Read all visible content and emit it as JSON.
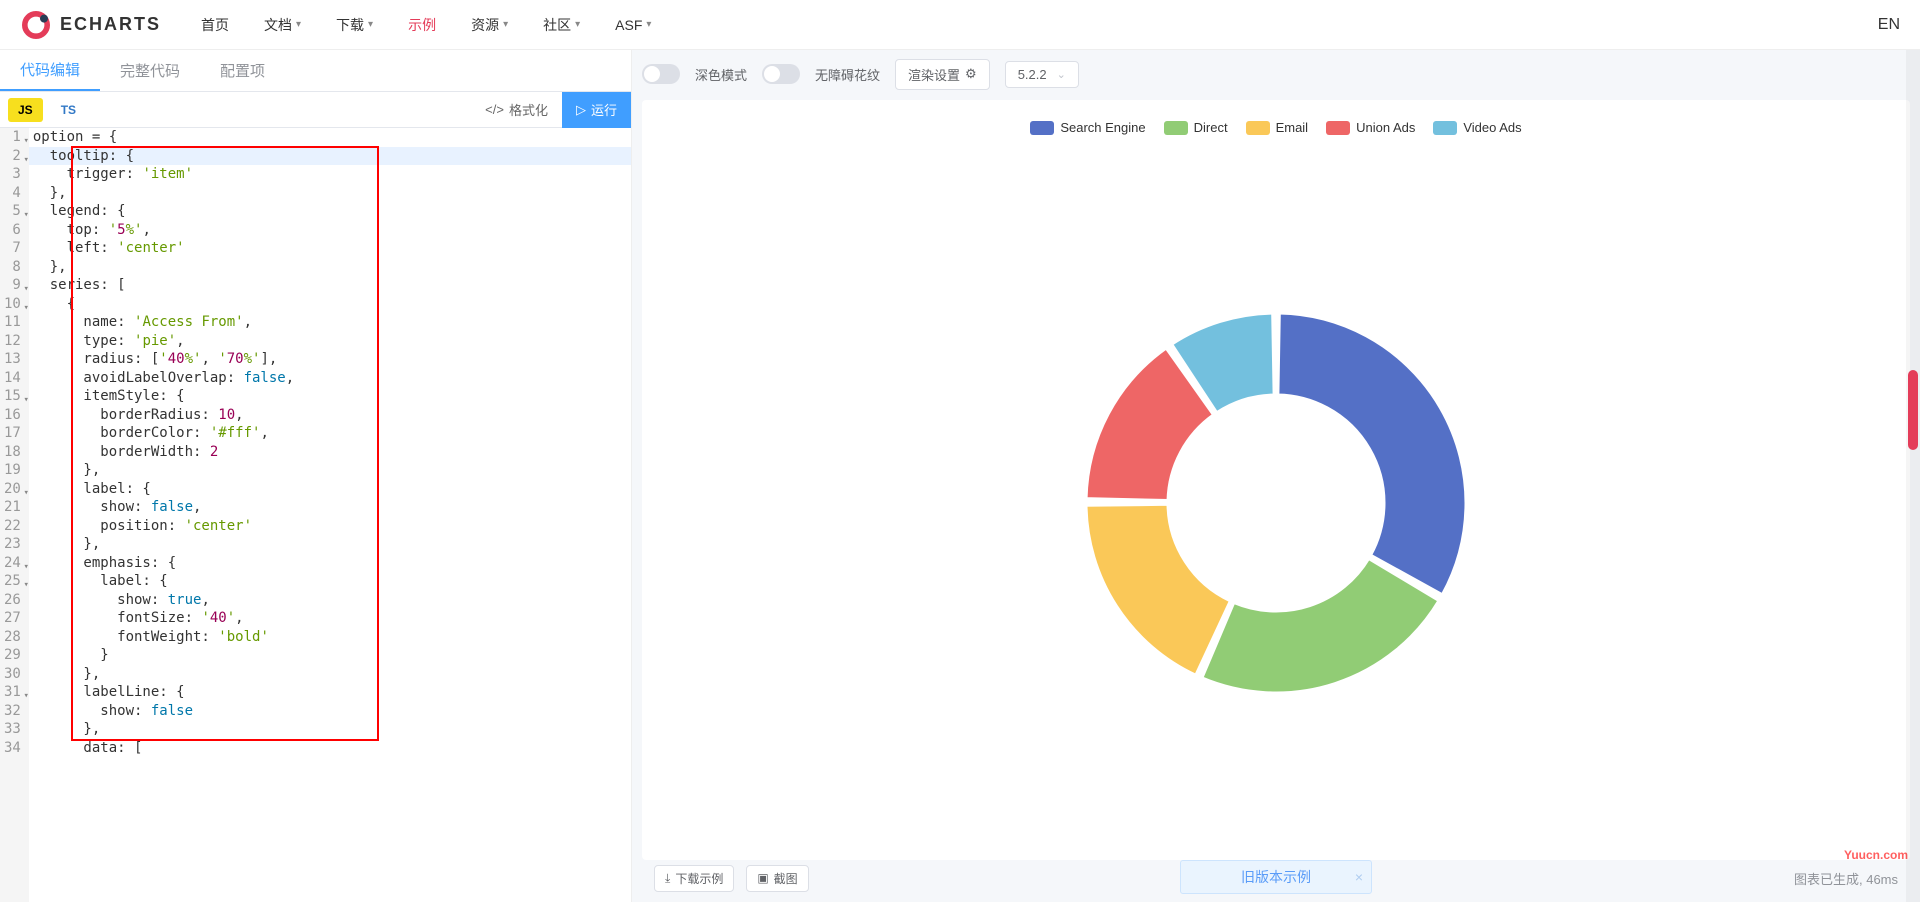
{
  "header": {
    "brand": "ECHARTS",
    "nav": [
      "首页",
      "文档",
      "下载",
      "示例",
      "资源",
      "社区",
      "ASF"
    ],
    "nav_has_chev": [
      false,
      true,
      true,
      false,
      true,
      true,
      true
    ],
    "active_index": 3,
    "lang": "EN"
  },
  "sub_tabs": {
    "items": [
      "代码编辑",
      "完整代码",
      "配置项"
    ],
    "active": 0
  },
  "lang_buttons": {
    "js": "JS",
    "ts": "TS"
  },
  "actions": {
    "format": "格式化",
    "run": "运行"
  },
  "controls": {
    "dark_mode": "深色模式",
    "a11y": "无障碍花纹",
    "render": "渲染设置",
    "version": "5.2.2"
  },
  "editor_lines": [
    "option = {",
    "  tooltip: {",
    "    trigger: 'item'",
    "  },",
    "  legend: {",
    "    top: '5%',",
    "    left: 'center'",
    "  },",
    "  series: [",
    "    {",
    "      name: 'Access From',",
    "      type: 'pie',",
    "      radius: ['40%', '70%'],",
    "      avoidLabelOverlap: false,",
    "      itemStyle: {",
    "        borderRadius: 10,",
    "        borderColor: '#fff',",
    "        borderWidth: 2",
    "      },",
    "      label: {",
    "        show: false,",
    "        position: 'center'",
    "      },",
    "      emphasis: {",
    "        label: {",
    "          show: true,",
    "          fontSize: '40',",
    "          fontWeight: 'bold'",
    "        }",
    "      },",
    "      labelLine: {",
    "        show: false",
    "      },",
    "      data: ["
  ],
  "foldable": [
    1,
    2,
    5,
    9,
    10,
    15,
    20,
    24,
    25,
    31
  ],
  "highlighted_line": 2,
  "chart_data": {
    "type": "pie",
    "subtype": "doughnut",
    "series_name": "Access From",
    "radius_inner_pct": 40,
    "radius_outer_pct": 70,
    "border_radius": 10,
    "border_color": "#fff",
    "border_width": 2,
    "legend_position": "top-center",
    "items": [
      {
        "name": "Search Engine",
        "value": 1048,
        "color": "#5470c6"
      },
      {
        "name": "Direct",
        "value": 735,
        "color": "#91cc75"
      },
      {
        "name": "Email",
        "value": 580,
        "color": "#fac858"
      },
      {
        "name": "Union Ads",
        "value": 484,
        "color": "#ee6666"
      },
      {
        "name": "Video Ads",
        "value": 300,
        "color": "#73c0de"
      }
    ]
  },
  "footer": {
    "download": "下载示例",
    "screenshot": "截图",
    "banner": "旧版本示例",
    "status": "图表已生成, 46ms",
    "watermark": "Yuucn.com"
  }
}
